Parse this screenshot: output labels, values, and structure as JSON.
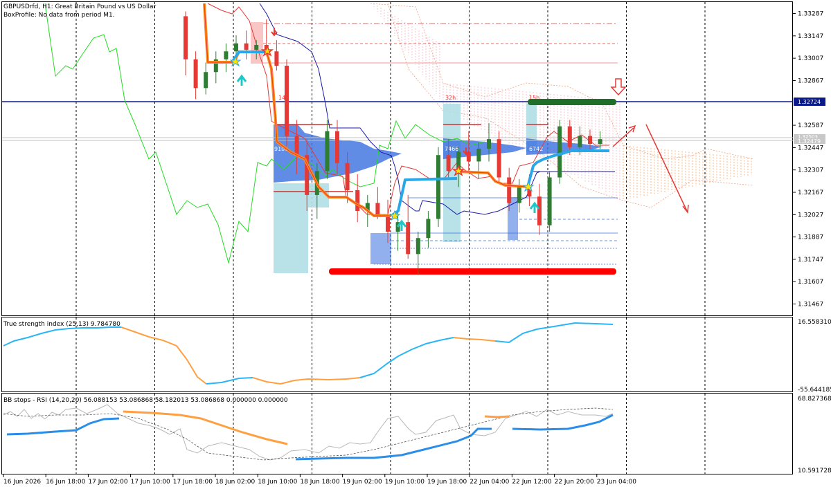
{
  "header": {
    "line1": "GBPUSDrfd, H1:  Great Britain Pound vs US Dollar",
    "line2": "BoxProfile: No data from period M1."
  },
  "colors": {
    "bull": "#2e7d32",
    "bear": "#e53935",
    "tenkan": "#e53935",
    "kijun": "#1a1aa8",
    "chikou": "#22dd22",
    "trend_up": "#2aa7e8",
    "trend_down": "#ff8c1a",
    "profile": "#3a6fe0",
    "profile_light": "#b0dfe6",
    "hline_blue": "#0a1a8a"
  },
  "price_axis": {
    "ticks": [
      "1.33287",
      "1.33147",
      "1.33007",
      "1.32867",
      "1.32587",
      "1.32447",
      "1.32307",
      "1.32167",
      "1.32027",
      "1.31887",
      "1.31747",
      "1.31607",
      "1.31467"
    ],
    "current_label": "1.32724",
    "bid_label": "1.32479",
    "ask_label": "1.32503"
  },
  "time_axis": [
    "16 Jun 2026",
    "16 Jun 18:00",
    "17 Jun 02:00",
    "17 Jun 10:00",
    "17 Jun 18:00",
    "18 Jun 02:00",
    "18 Jun 10:00",
    "18 Jun 18:00",
    "19 Jun 02:00",
    "19 Jun 10:00",
    "19 Jun 18:00",
    "22 Jun 04:00",
    "22 Jun 12:00",
    "22 Jun 20:00",
    "23 Jun 04:00"
  ],
  "profile_labels": {
    "p1": "9106",
    "p2": "7466",
    "p3": "6742",
    "h1": "14h",
    "h2": "32h",
    "h3": "15h"
  },
  "tsi": {
    "title": "True strength index (25,13) 9.784780",
    "max_label": "16.558310",
    "min_label": "-55.644185"
  },
  "rsi": {
    "title": "BB stops - RSI (14,20,20) 56.088153 53.086868 58.182013 53.086868 0.000000 0.000000",
    "max_label": "68.827368",
    "min_label": "10.591728"
  },
  "chart_data": [
    {
      "type": "candlestick",
      "title": "GBPUSDrfd, H1:  Great Britain Pound vs US Dollar",
      "timeframe": "H1",
      "x_ticks": [
        "16 Jun 2026",
        "16 Jun 18:00",
        "17 Jun 02:00",
        "17 Jun 10:00",
        "17 Jun 18:00",
        "18 Jun 02:00",
        "18 Jun 10:00",
        "18 Jun 18:00",
        "19 Jun 02:00",
        "19 Jun 10:00",
        "19 Jun 18:00",
        "22 Jun 04:00",
        "22 Jun 12:00",
        "22 Jun 20:00",
        "23 Jun 04:00"
      ],
      "ylim": [
        1.314,
        1.3335
      ],
      "y_ticks": [
        1.33287,
        1.33147,
        1.33007,
        1.32867,
        1.32587,
        1.32447,
        1.32307,
        1.32167,
        1.32027,
        1.31887,
        1.31747,
        1.31607,
        1.31467
      ],
      "horizontal_line": 1.32724,
      "bid": 1.32479,
      "ask": 1.32503,
      "grid": "vertical dotted",
      "ohlc_points": [
        [
          1.3327,
          1.333,
          1.329,
          1.33
        ],
        [
          1.33,
          1.3305,
          1.3275,
          1.3282
        ],
        [
          1.3282,
          1.3298,
          1.3278,
          1.3292
        ],
        [
          1.3292,
          1.3305,
          1.3285,
          1.33
        ],
        [
          1.33,
          1.331,
          1.3292,
          1.3305
        ],
        [
          1.3305,
          1.3315,
          1.3298,
          1.331
        ],
        [
          1.331,
          1.3318,
          1.33,
          1.3306
        ],
        [
          1.3306,
          1.3312,
          1.33,
          1.3309
        ],
        [
          1.3309,
          1.3325,
          1.3302,
          1.3305
        ],
        [
          1.3305,
          1.3312,
          1.3293,
          1.3296
        ],
        [
          1.3296,
          1.33,
          1.3245,
          1.3252
        ],
        [
          1.3252,
          1.3262,
          1.3228,
          1.324
        ],
        [
          1.324,
          1.325,
          1.3205,
          1.3215
        ],
        [
          1.3215,
          1.3235,
          1.32,
          1.323
        ],
        [
          1.323,
          1.3262,
          1.3225,
          1.3255
        ],
        [
          1.3255,
          1.3262,
          1.3228,
          1.3235
        ],
        [
          1.3235,
          1.3242,
          1.321,
          1.3218
        ],
        [
          1.3218,
          1.3228,
          1.3198,
          1.3205
        ],
        [
          1.3205,
          1.3215,
          1.3195,
          1.321
        ],
        [
          1.321,
          1.322,
          1.32,
          1.3202
        ],
        [
          1.3202,
          1.3212,
          1.3185,
          1.3192
        ],
        [
          1.3192,
          1.3205,
          1.318,
          1.3198
        ],
        [
          1.3198,
          1.3215,
          1.3175,
          1.3178
        ],
        [
          1.3178,
          1.3192,
          1.3165,
          1.3188
        ],
        [
          1.3188,
          1.3205,
          1.3182,
          1.32
        ],
        [
          1.32,
          1.3245,
          1.3195,
          1.324
        ],
        [
          1.324,
          1.325,
          1.3225,
          1.323
        ],
        [
          1.323,
          1.3245,
          1.322,
          1.3242
        ],
        [
          1.3242,
          1.3255,
          1.323,
          1.3236
        ],
        [
          1.3236,
          1.3248,
          1.3225,
          1.3244
        ],
        [
          1.3244,
          1.326,
          1.3236,
          1.325
        ],
        [
          1.325,
          1.3255,
          1.3222,
          1.3226
        ],
        [
          1.3226,
          1.3232,
          1.3205,
          1.321
        ],
        [
          1.321,
          1.3225,
          1.3204,
          1.322
        ],
        [
          1.322,
          1.3228,
          1.3208,
          1.3214
        ],
        [
          1.3214,
          1.3222,
          1.319,
          1.3196
        ],
        [
          1.3196,
          1.323,
          1.3192,
          1.3226
        ],
        [
          1.3226,
          1.3262,
          1.3222,
          1.3258
        ],
        [
          1.3258,
          1.3262,
          1.324,
          1.3245
        ],
        [
          1.3245,
          1.3258,
          1.324,
          1.3252
        ],
        [
          1.3252,
          1.3256,
          1.3242,
          1.3247
        ],
        [
          1.3247,
          1.3255,
          1.3244,
          1.325
        ]
      ]
    },
    {
      "type": "line",
      "title": "True strength index (25,13) 9.784780",
      "ylim": [
        -55.644185,
        16.55831
      ],
      "series": [
        {
          "values": [
            -5,
            0,
            5,
            8,
            12,
            14,
            10,
            2,
            -20,
            -48,
            -53,
            -50,
            -47,
            -49,
            -52,
            -52,
            -52,
            -51,
            -43,
            -30,
            -15,
            -5,
            0,
            3,
            1,
            2,
            0,
            8,
            13,
            14,
            12,
            13
          ]
        }
      ]
    },
    {
      "type": "line",
      "title": "BB stops - RSI (14,20,20) 56.088153 53.086868 58.182013 53.086868 0.000000 0.000000",
      "ylim": [
        10.591728,
        68.827368
      ],
      "series": [
        {
          "values": [
            64,
            62,
            60,
            56,
            48,
            40,
            34,
            28,
            20,
            18,
            18,
            32,
            46,
            45,
            42,
            50,
            58,
            62,
            60,
            64,
            58,
            60,
            56,
            58
          ]
        }
      ]
    }
  ]
}
